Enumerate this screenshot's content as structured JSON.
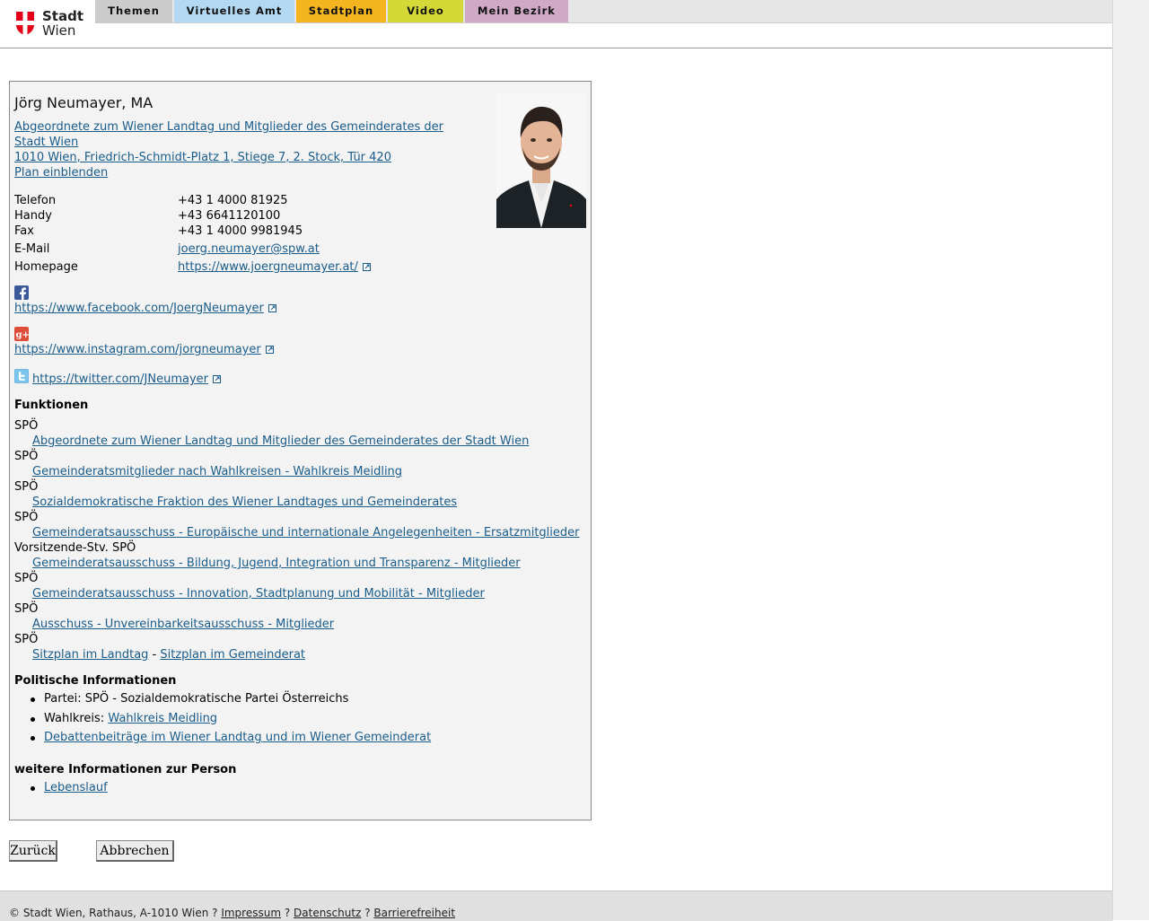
{
  "logo": {
    "line1": "Stadt",
    "line2": "Wien"
  },
  "nav": [
    {
      "label": "Themen",
      "color": "#cccccc"
    },
    {
      "label": "Virtuelles Amt",
      "color": "#b3d9f2"
    },
    {
      "label": "Stadtplan",
      "color": "#f5b51f"
    },
    {
      "label": "Video",
      "color": "#d4d938"
    },
    {
      "label": "Mein Bezirk",
      "color": "#cfa9c6"
    }
  ],
  "person": {
    "name": "Jörg Neumayer, MA",
    "address_line1": "Abgeordnete zum Wiener Landtag und Mitglieder des Gemeinderates der",
    "address_line2": "Stadt Wien ",
    "address_line3": "1010 Wien, Friedrich-Schmidt-Platz 1, Stiege 7, 2. Stock, Tür 420",
    "plan_link": "Plan einblenden",
    "contacts": {
      "telefon_label": "Telefon",
      "telefon": "+43 1 4000 81925",
      "handy_label": "Handy",
      "handy": "+43 6641120100",
      "fax_label": "Fax",
      "fax": "+43 1 4000 9981945",
      "email_label": "E-Mail",
      "email": "joerg.neumayer@spw.at",
      "homepage_label": "Homepage",
      "homepage": "https://www.joergneumayer.at/"
    },
    "social": {
      "facebook": "https://www.facebook.com/JoergNeumayer",
      "instagram": "https://www.instagram.com/jorgneumayer",
      "twitter": "https://twitter.com/JNeumayer"
    }
  },
  "funktionen": {
    "heading": "Funktionen",
    "items": [
      {
        "role": "SPÖ",
        "link": "Abgeordnete zum Wiener Landtag und Mitglieder des Gemeinderates der Stadt Wien"
      },
      {
        "role": "SPÖ",
        "link": "Gemeinderatsmitglieder nach Wahlkreisen - Wahlkreis Meidling"
      },
      {
        "role": "SPÖ",
        "link": "Sozialdemokratische Fraktion des Wiener Landtages und Gemeinderates"
      },
      {
        "role": "SPÖ",
        "link": "Gemeinderatsausschuss - Europäische und internationale Angelegenheiten - Ersatzmitglieder"
      },
      {
        "role": "Vorsitzende-Stv. SPÖ",
        "link": "Gemeinderatsausschuss - Bildung, Jugend, Integration und Transparenz - Mitglieder"
      },
      {
        "role": "SPÖ",
        "link": "Gemeinderatsausschuss - Innovation, Stadtplanung und Mobilität - Mitglieder"
      },
      {
        "role": "SPÖ",
        "link": "Ausschuss - Unvereinbarkeitsausschuss - Mitglieder"
      },
      {
        "role": "SPÖ",
        "link_a": "Sitzplan im Landtag",
        "separator": " - ",
        "link_b": "Sitzplan im Gemeinderat"
      }
    ]
  },
  "politisch": {
    "heading": "Politische Informationen",
    "partei": "Partei: SPÖ - Sozialdemokratische Partei Österreichs",
    "wahlkreis_label": "Wahlkreis: ",
    "wahlkreis_link": "Wahlkreis Meidling",
    "debatten": "Debattenbeiträge im Wiener Landtag und im Wiener Gemeinderat"
  },
  "weitere": {
    "heading": "weitere Informationen zur Person",
    "lebenslauf": "Lebenslauf"
  },
  "buttons": {
    "back": "Zurück",
    "cancel": "Abbrechen"
  },
  "footer": {
    "copyright": "© Stadt Wien, Rathaus, A-1010 Wien ? ",
    "impressum": "Impressum",
    "sep": " ? ",
    "datenschutz": "Datenschutz",
    "barrierefreiheit": "Barrierefreiheit"
  }
}
